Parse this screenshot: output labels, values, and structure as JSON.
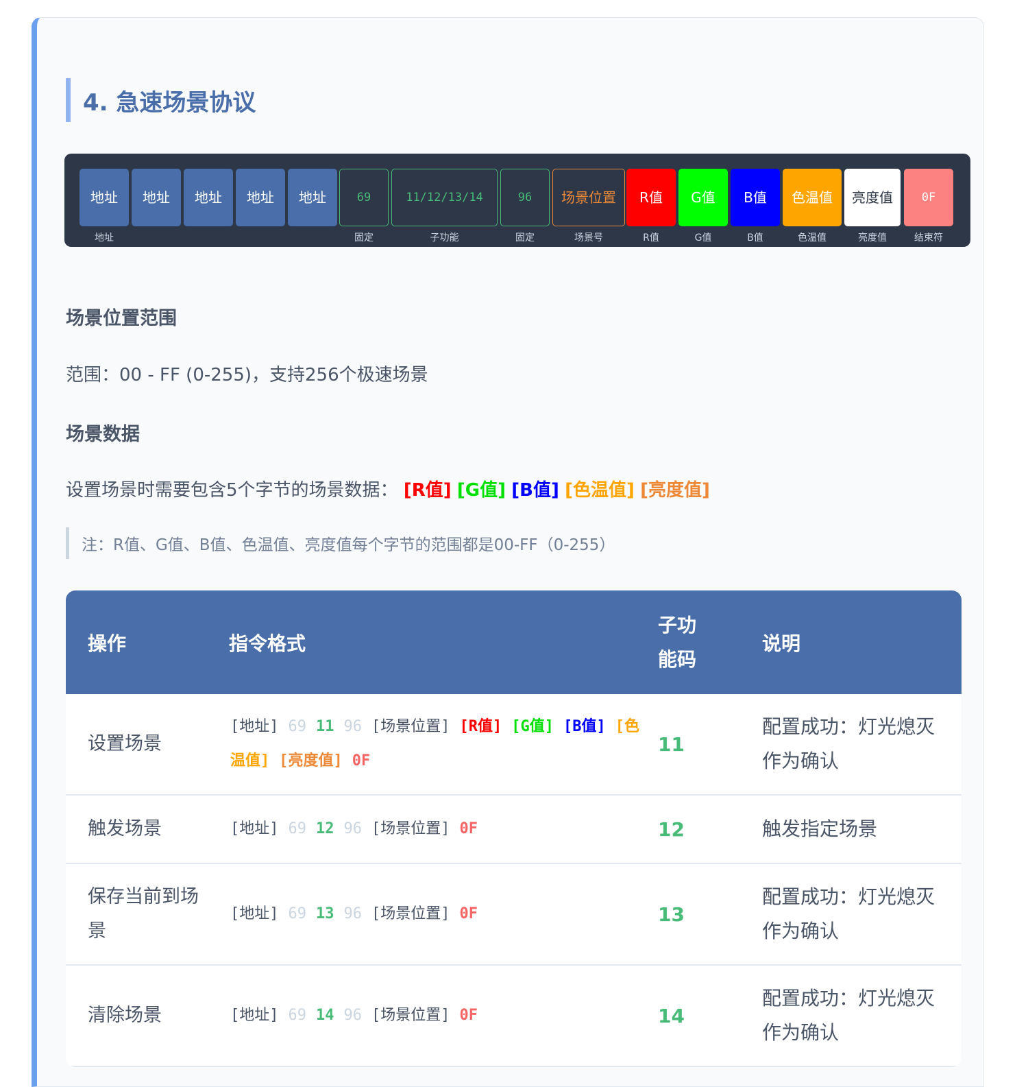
{
  "heading": "4. 急速场景协议",
  "packet": {
    "cells": [
      {
        "text": "地址",
        "kind": "addr",
        "label": "地址"
      },
      {
        "text": "地址",
        "kind": "addr",
        "label": ""
      },
      {
        "text": "地址",
        "kind": "addr",
        "label": ""
      },
      {
        "text": "地址",
        "kind": "addr",
        "label": ""
      },
      {
        "text": "地址",
        "kind": "addr",
        "label": ""
      },
      {
        "text": "69",
        "kind": "fix",
        "label": "固定"
      },
      {
        "text": "11/12/13/14",
        "kind": "fix",
        "label": "子功能"
      },
      {
        "text": "96",
        "kind": "fix",
        "label": "固定"
      },
      {
        "text": "场景位置",
        "kind": "sc",
        "label": "场景号"
      },
      {
        "text": "R值",
        "kind": "r",
        "label": "R值"
      },
      {
        "text": "G值",
        "kind": "g",
        "label": "G值"
      },
      {
        "text": "B值",
        "kind": "b",
        "label": "B值"
      },
      {
        "text": "色温值",
        "kind": "ct",
        "label": "色温值"
      },
      {
        "text": "亮度值",
        "kind": "br",
        "label": "亮度值"
      },
      {
        "text": "0F",
        "kind": "end",
        "label": "结束符"
      }
    ],
    "colors": {
      "r": "#ff0000",
      "g": "#00ff00",
      "b": "#0000ff",
      "ct": "#ffa500",
      "br": "#ffffff",
      "end": "#fc8181"
    }
  },
  "section1": {
    "title": "场景位置范围",
    "text": "范围：00 - FF (0-255)，支持256个极速场景"
  },
  "section2": {
    "title": "场景数据",
    "intro": "设置场景时需要包含5个字节的场景数据：",
    "r": "[R值]",
    "g": "[G值]",
    "b": "[B值]",
    "ct": "[色温值]",
    "br": "[亮度值]"
  },
  "note": "注：R值、G值、B值、色温值、亮度值每个字节的范围都是00-FF（0-255）",
  "table": {
    "headers": {
      "op": "操作",
      "fmt": "指令格式",
      "code": "子功能码",
      "desc": "说明"
    },
    "rows": [
      {
        "op": "设置场景",
        "code": "11",
        "desc": "配置成功：灯光熄灭作为确认",
        "tokens": [
          [
            "[地址]",
            ""
          ],
          [
            "69",
            "gray"
          ],
          [
            "11",
            "grn"
          ],
          [
            "96",
            "gray"
          ],
          [
            "[场景位置]",
            ""
          ],
          [
            "[R值]",
            "red"
          ],
          [
            "[G值]",
            "gr2"
          ],
          [
            "[B值]",
            "blu"
          ],
          [
            "[色温值]",
            "org"
          ],
          [
            "[亮度值]",
            "org2"
          ],
          [
            "0F",
            "end"
          ]
        ]
      },
      {
        "op": "触发场景",
        "code": "12",
        "desc": "触发指定场景",
        "tokens": [
          [
            "[地址]",
            ""
          ],
          [
            "69",
            "gray"
          ],
          [
            "12",
            "grn"
          ],
          [
            "96",
            "gray"
          ],
          [
            "[场景位置]",
            ""
          ],
          [
            "0F",
            "end"
          ]
        ]
      },
      {
        "op": "保存当前到场景",
        "code": "13",
        "desc": "配置成功：灯光熄灭作为确认",
        "tokens": [
          [
            "[地址]",
            ""
          ],
          [
            "69",
            "gray"
          ],
          [
            "13",
            "grn"
          ],
          [
            "96",
            "gray"
          ],
          [
            "[场景位置]",
            ""
          ],
          [
            "0F",
            "end"
          ]
        ]
      },
      {
        "op": "清除场景",
        "code": "14",
        "desc": "配置成功：灯光熄灭作为确认",
        "tokens": [
          [
            "[地址]",
            ""
          ],
          [
            "69",
            "gray"
          ],
          [
            "14",
            "grn"
          ],
          [
            "96",
            "gray"
          ],
          [
            "[场景位置]",
            ""
          ],
          [
            "0F",
            "end"
          ]
        ]
      }
    ]
  }
}
